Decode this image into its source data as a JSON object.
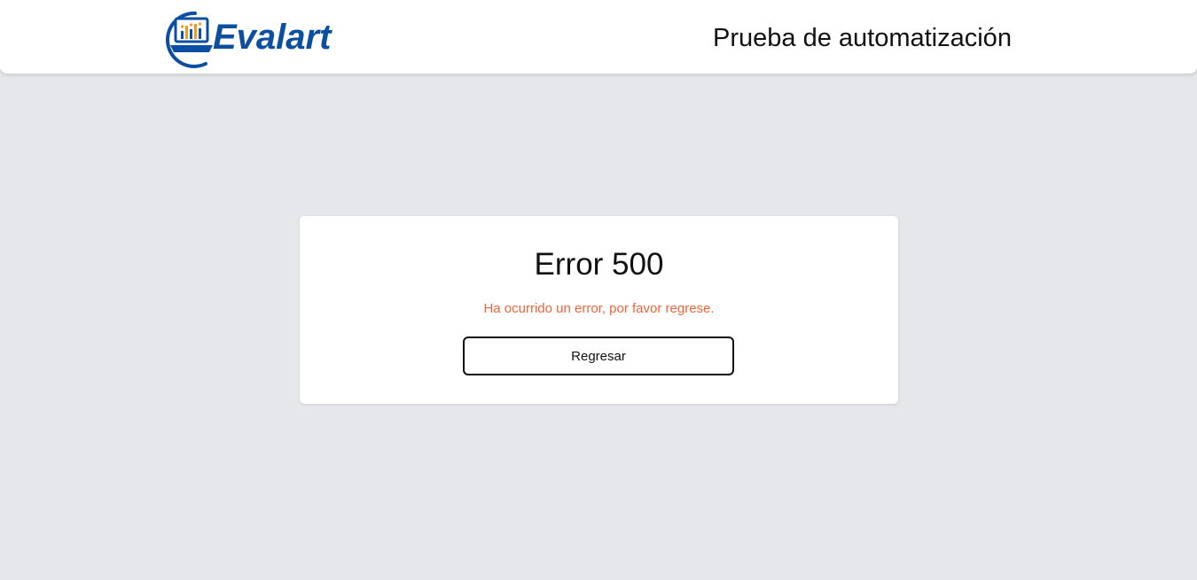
{
  "header": {
    "logo_text": "Evalart",
    "title": "Prueba de automatización"
  },
  "error": {
    "title": "Error 500",
    "message": "Ha ocurrido un error, por favor regrese.",
    "button_label": "Regresar"
  },
  "colors": {
    "background": "#e5e7eb",
    "brand_blue": "#0c4fa0",
    "brand_orange": "#f39a1e",
    "error_text": "#f0643c"
  }
}
